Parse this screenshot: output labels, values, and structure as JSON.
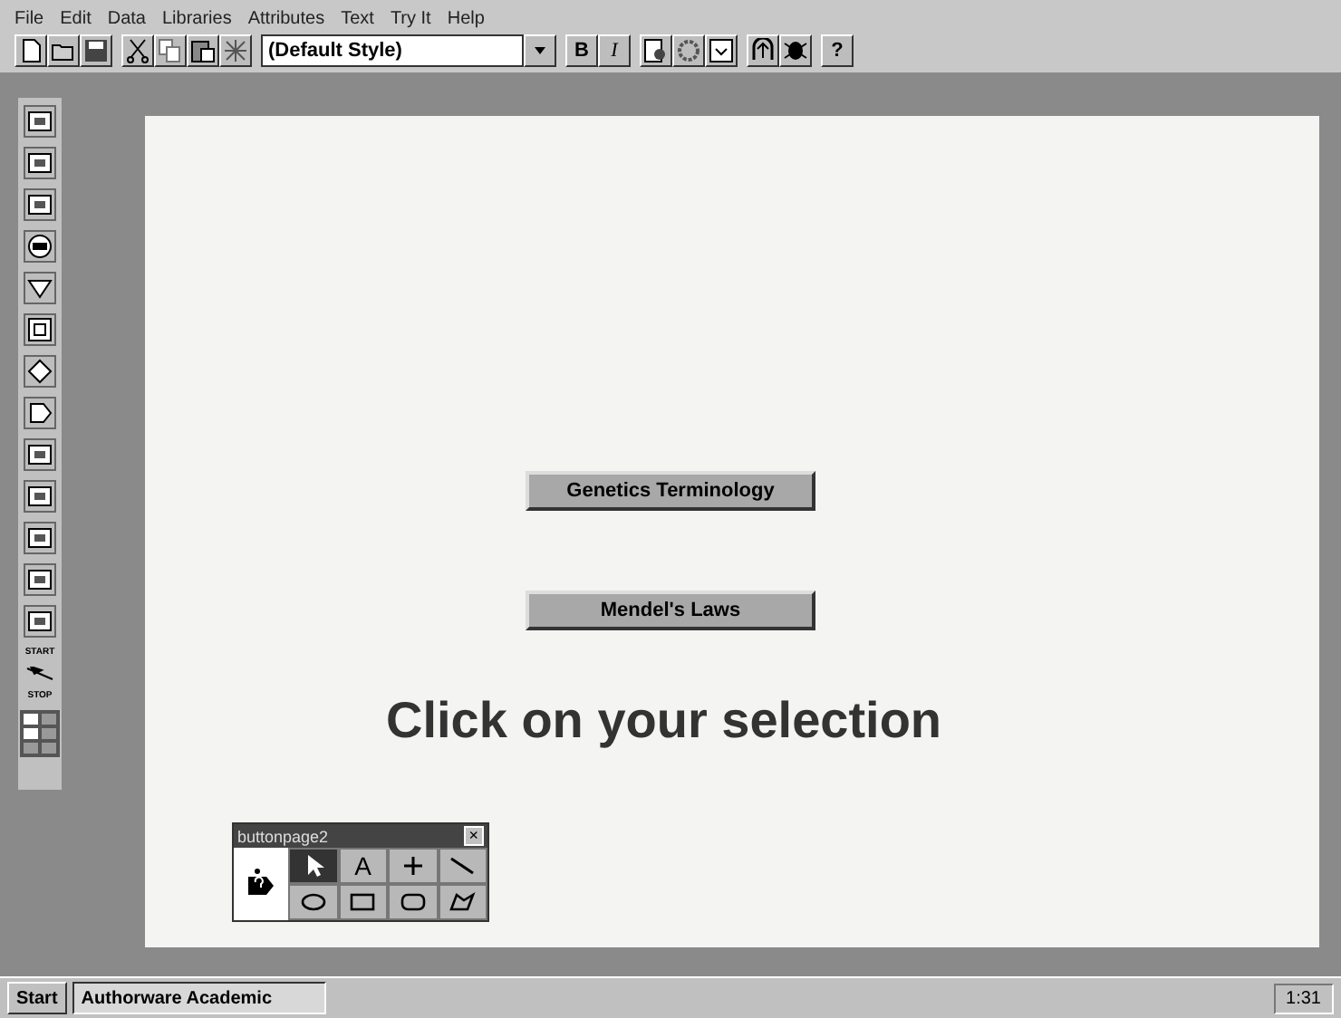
{
  "menu": [
    "File",
    "Edit",
    "Data",
    "Libraries",
    "Attributes",
    "Text",
    "Try It",
    "Help"
  ],
  "toolbar": {
    "style_field": "(Default Style)",
    "bold": "B",
    "italic": "I",
    "help": "?"
  },
  "icon_palette": {
    "start_label": "START",
    "stop_label": "STOP"
  },
  "canvas": {
    "buttons": [
      "Genetics Terminology",
      "Mendel's Laws"
    ],
    "prompt": "Click on your selection"
  },
  "tool_window": {
    "title": "buttonpage2",
    "close": "×",
    "tools": [
      {
        "kind": "arrow",
        "selected": true
      },
      {
        "kind": "text",
        "label": "A",
        "selected": false
      },
      {
        "kind": "cross",
        "selected": false
      },
      {
        "kind": "line",
        "selected": false
      },
      {
        "kind": "oval",
        "selected": false
      },
      {
        "kind": "rect",
        "selected": false
      },
      {
        "kind": "rounded",
        "selected": false
      },
      {
        "kind": "polygon",
        "selected": false
      }
    ]
  },
  "taskbar": {
    "start": "Start",
    "task": "Authorware Academic",
    "clock": "1:31"
  }
}
